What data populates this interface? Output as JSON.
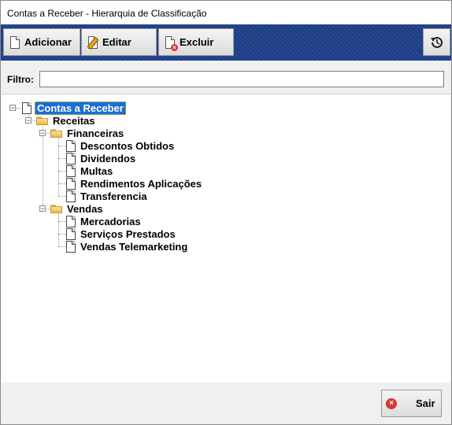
{
  "window": {
    "title": "Contas a Receber - Hierarquia de Classificação"
  },
  "toolbar": {
    "add_label": "Adicionar",
    "edit_label": "Editar",
    "delete_label": "Excluir",
    "history_icon": "history-icon"
  },
  "filter": {
    "label": "Filtro:",
    "value": "",
    "placeholder": ""
  },
  "tree": {
    "root": "Contas a Receber",
    "receitas": "Receitas",
    "financeiras": "Financeiras",
    "financeiras_items": [
      "Descontos Obtidos",
      "Dividendos",
      "Multas",
      "Rendimentos Aplicações",
      "Transferencia"
    ],
    "vendas": "Vendas",
    "vendas_items": [
      "Mercadorias",
      "Serviços Prestados",
      "Vendas Telemarketing"
    ]
  },
  "footer": {
    "exit_label": "Sair"
  },
  "colors": {
    "toolbar_bg": "#1c3f8a",
    "selection": "#1a6fd3"
  }
}
